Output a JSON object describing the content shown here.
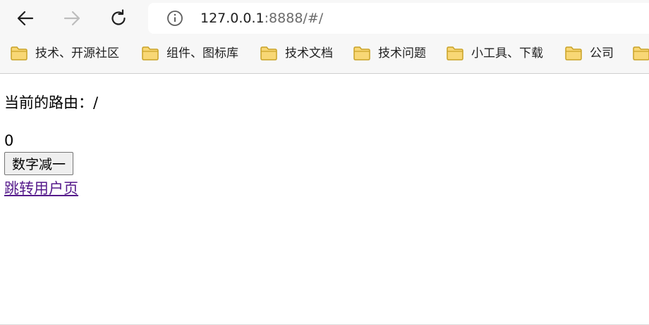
{
  "browser": {
    "url_host": "127.0.0.1",
    "url_path": ":8888/#/",
    "bookmarks": [
      {
        "label": "技术、开源社区",
        "icon": "folder-icon"
      },
      {
        "label": "组件、图标库",
        "icon": "folder-icon"
      },
      {
        "label": "技术文档",
        "icon": "folder-icon"
      },
      {
        "label": "技术问题",
        "icon": "folder-icon"
      },
      {
        "label": "小工具、下载",
        "icon": "folder-icon"
      },
      {
        "label": "公司",
        "icon": "folder-icon"
      },
      {
        "label": "",
        "icon": "folder-icon"
      }
    ],
    "colors": {
      "folder_fill": "#f8d775",
      "folder_stroke": "#c9a227",
      "chrome_bg": "#f7f7f7"
    }
  },
  "page": {
    "route_label": "当前的路由：/",
    "count": "0",
    "decrement_label": "数字减一",
    "user_link_label": "跳转用户页",
    "colors": {
      "visited_link": "#551a8b"
    }
  }
}
